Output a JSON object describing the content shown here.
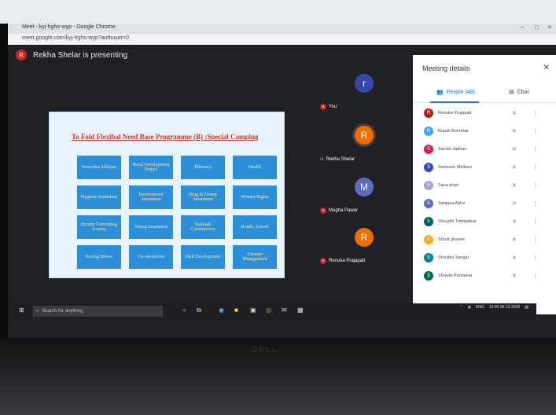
{
  "browser": {
    "title": "Meet - kyj-hgho-wyp - Google Chrome",
    "url": "meet.google.com/kyj-hgho-wyp?authuser=0"
  },
  "presenter": {
    "initial": "R",
    "text": "Rekha Shelar is presenting"
  },
  "slide": {
    "title": "To Fold Flexibal Need Base Programme (B) :Special Camping",
    "cells": [
      "Swacchta Abhiyan",
      "Rural Development Project",
      "Illiteracy",
      "Health",
      "Hygiene Sanitation",
      "Environment Awareness",
      "Drug & Dowry Awareness",
      "Women Rights",
      "Income Generating Course",
      "Voting Awareness",
      "Balwadi Construction",
      "Roads, School",
      "Saving Drives",
      "Co-operatives",
      "Skill Development",
      "Disaster Management"
    ]
  },
  "tiles": [
    {
      "initial": "r",
      "name": "You",
      "color": "#3949ab"
    },
    {
      "initial": "R",
      "name": "Rekha Shelar",
      "color": "#ef6c00"
    },
    {
      "initial": "M",
      "name": "Megha Pawar",
      "color": "#5c6bc0"
    },
    {
      "initial": "R",
      "name": "Renuka Prajapati",
      "color": "#ef6c00"
    }
  ],
  "panel": {
    "header": "Meeting details",
    "close_icon": "close-icon",
    "tab_people": "People (48)",
    "tab_chat": "Chat",
    "participants": [
      {
        "initial": "R",
        "name": "Renuka Prajapati",
        "color": "#b71c1c"
      },
      {
        "initial": "R",
        "name": "Rupali Barvekar",
        "color": "#42a5f5"
      },
      {
        "initial": "S",
        "name": "Sachin Jadhav",
        "color": "#d81b60"
      },
      {
        "initial": "S",
        "name": "Samreen Malkani",
        "color": "#3949ab"
      },
      {
        "initial": "S",
        "name": "Sana khan",
        "color": "#b39ddb"
      },
      {
        "initial": "S",
        "name": "Sanjana Ahire",
        "color": "#5c6bc0"
      },
      {
        "initial": "S",
        "name": "Shrushti Trimbakkar",
        "color": "#006064"
      },
      {
        "initial": "S",
        "name": "Shruti gharew",
        "color": "#f9a825"
      },
      {
        "initial": "S",
        "name": "Shrutika Sangar",
        "color": "#00838f"
      },
      {
        "initial": "S",
        "name": "Shweta Parvarkar",
        "color": "#00695c"
      }
    ]
  },
  "taskbar": {
    "search_placeholder": "Search for anything",
    "lang": "ENG",
    "time": "13:00",
    "date": "06-12-2020"
  },
  "brand": "DELL"
}
